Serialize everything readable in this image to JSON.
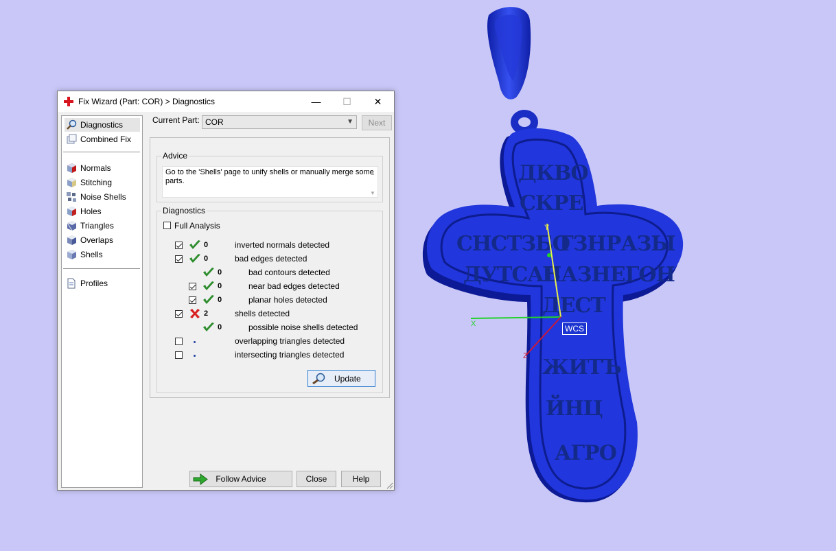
{
  "window": {
    "title": "Fix Wizard (Part: COR) > Diagnostics",
    "minimize_glyph": "—",
    "maximize_glyph": "☐",
    "close_glyph": "✕"
  },
  "nav": {
    "top": [
      "Diagnostics",
      "Combined Fix"
    ],
    "fixes": [
      "Normals",
      "Stitching",
      "Noise Shells",
      "Holes",
      "Triangles",
      "Overlaps",
      "Shells"
    ],
    "bottom": [
      "Profiles"
    ],
    "selected": "Diagnostics"
  },
  "header": {
    "current_part_label": "Current Part:",
    "current_part_value": "COR",
    "next_label": "Next"
  },
  "advice": {
    "title": "Advice",
    "text": "Go to the 'Shells' page to unify shells or manually merge some parts."
  },
  "diagnostics": {
    "title": "Diagnostics",
    "full_analysis_label": "Full Analysis",
    "full_analysis_checked": false,
    "rows": [
      {
        "count": "0",
        "label": "inverted normals detected",
        "status": "ok",
        "checked": true,
        "indent": 0
      },
      {
        "count": "0",
        "label": "bad edges detected",
        "status": "ok",
        "checked": true,
        "indent": 0
      },
      {
        "count": "0",
        "label": "bad contours detected",
        "status": "ok",
        "checked": null,
        "indent": 1
      },
      {
        "count": "0",
        "label": "near bad edges detected",
        "status": "ok",
        "checked": true,
        "indent": 1
      },
      {
        "count": "0",
        "label": "planar holes detected",
        "status": "ok",
        "checked": true,
        "indent": 1
      },
      {
        "count": "2",
        "label": "shells detected",
        "status": "error",
        "checked": true,
        "indent": 0
      },
      {
        "count": "0",
        "label": "possible noise shells detected",
        "status": "ok",
        "checked": null,
        "indent": 1
      },
      {
        "count": "",
        "label": "overlapping triangles detected",
        "status": "none",
        "checked": false,
        "indent": 0
      },
      {
        "count": "",
        "label": "intersecting triangles detected",
        "status": "none",
        "checked": false,
        "indent": 0
      }
    ],
    "update_label": "Update"
  },
  "footer": {
    "follow_advice_label": "Follow Advice",
    "close_label": "Close",
    "help_label": "Help"
  },
  "viewport": {
    "background": "#c9c7f7",
    "model_color": "#1f33d6",
    "axis_x_label": "X",
    "axis_y_label": "Y",
    "axis_z_label": "Z",
    "wcs_label": "WCS",
    "engraving": [
      "ДКВО",
      "СКРЕ",
      "СНСТЗБО",
      "ГЗНРАЗЫ",
      "ДУТСАВ",
      "ПАЗНЕГОН",
      "ДЕСТ",
      "ЖИТЪ",
      "ЙНЦ",
      "АГРО"
    ]
  }
}
